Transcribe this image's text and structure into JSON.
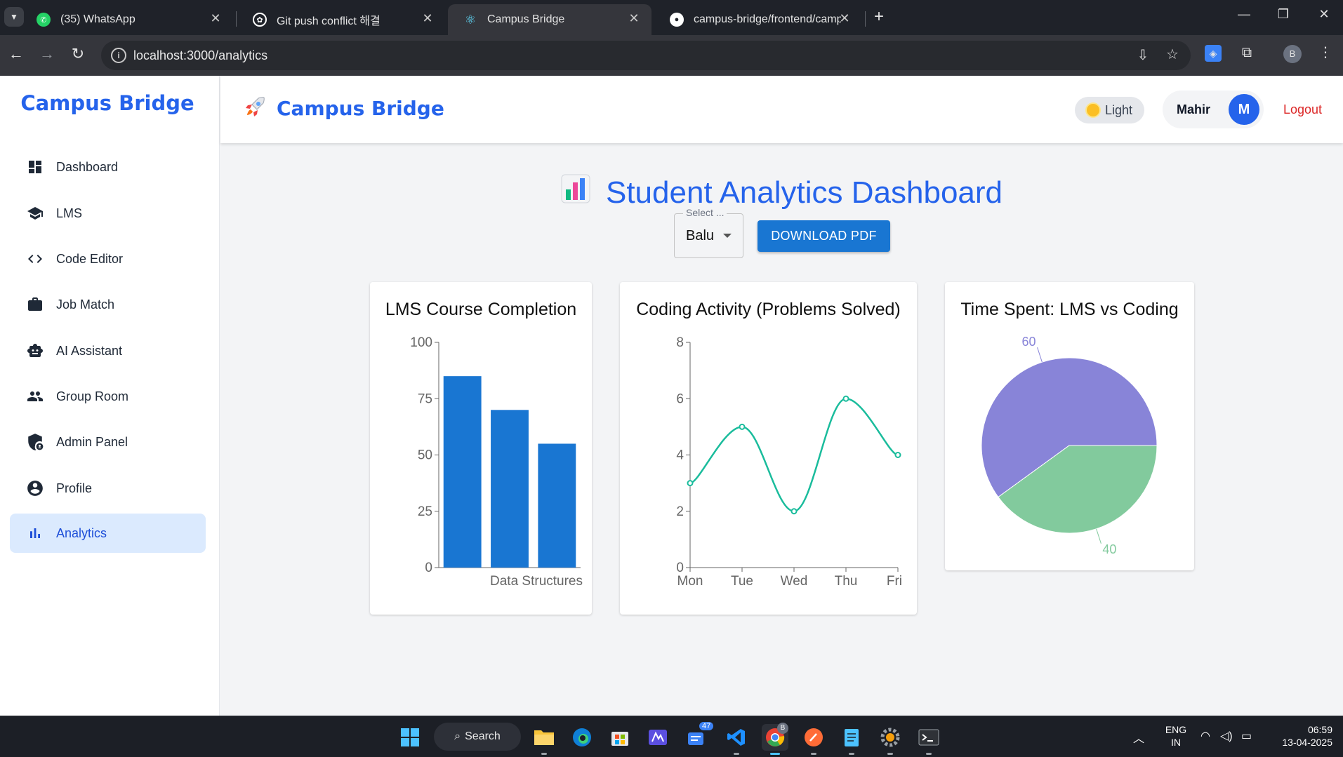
{
  "browser": {
    "tabs": [
      {
        "title": "(35) WhatsApp",
        "icon": "whatsapp-icon",
        "color": "#25d366"
      },
      {
        "title": "Git push conflict 해결",
        "icon": "openai-icon",
        "color": "#ffffff"
      },
      {
        "title": "Campus Bridge",
        "icon": "react-icon",
        "color": "#61dafb"
      },
      {
        "title": "campus-bridge/frontend/camp",
        "icon": "github-icon",
        "color": "#ffffff"
      }
    ],
    "url": "localhost:3000/analytics",
    "profile_initial": "B"
  },
  "sidebar": {
    "brand": "Campus Bridge",
    "items": [
      {
        "label": "Dashboard",
        "icon": "dashboard-icon"
      },
      {
        "label": "LMS",
        "icon": "graduation-cap-icon"
      },
      {
        "label": "Code Editor",
        "icon": "code-icon"
      },
      {
        "label": "Job Match",
        "icon": "briefcase-icon"
      },
      {
        "label": "AI Assistant",
        "icon": "robot-icon"
      },
      {
        "label": "Group Room",
        "icon": "group-icon"
      },
      {
        "label": "Admin Panel",
        "icon": "admin-shield-icon"
      },
      {
        "label": "Profile",
        "icon": "account-circle-icon"
      },
      {
        "label": "Analytics",
        "icon": "bar-chart-icon",
        "active": true
      }
    ]
  },
  "topbar": {
    "title": "Campus Bridge",
    "theme_label": "Light",
    "user_name": "Mahir",
    "avatar_initial": "M",
    "logout_label": "Logout"
  },
  "page": {
    "title": "Student Analytics Dashboard",
    "select_label": "Select ...",
    "select_value": "Balu",
    "download_label": "DOWNLOAD PDF"
  },
  "chart_data": [
    {
      "type": "bar",
      "title": "LMS Course Completion",
      "categories": [
        "",
        "",
        ""
      ],
      "visible_tick_label": "Data Structures",
      "values": [
        85,
        70,
        55
      ],
      "ylim": [
        0,
        100
      ],
      "yticks": [
        0,
        25,
        50,
        75,
        100
      ],
      "color": "#1976d2"
    },
    {
      "type": "line",
      "title": "Coding Activity (Problems Solved)",
      "categories": [
        "Mon",
        "Tue",
        "Wed",
        "Thu",
        "Fri"
      ],
      "values": [
        3,
        5,
        2,
        6,
        4
      ],
      "ylim": [
        0,
        8
      ],
      "yticks": [
        0,
        2,
        4,
        6,
        8
      ],
      "color": "#1abc9c"
    },
    {
      "type": "pie",
      "title": "Time Spent: LMS vs Coding",
      "slices": [
        {
          "value": 60,
          "color": "#8884d8"
        },
        {
          "value": 40,
          "color": "#82ca9d"
        }
      ]
    }
  ],
  "taskbar": {
    "search_label": "Search",
    "badge_count": "47",
    "chrome_badge": "B",
    "lang_line1": "ENG",
    "lang_line2": "IN",
    "time": "06:59",
    "date": "13-04-2025"
  }
}
